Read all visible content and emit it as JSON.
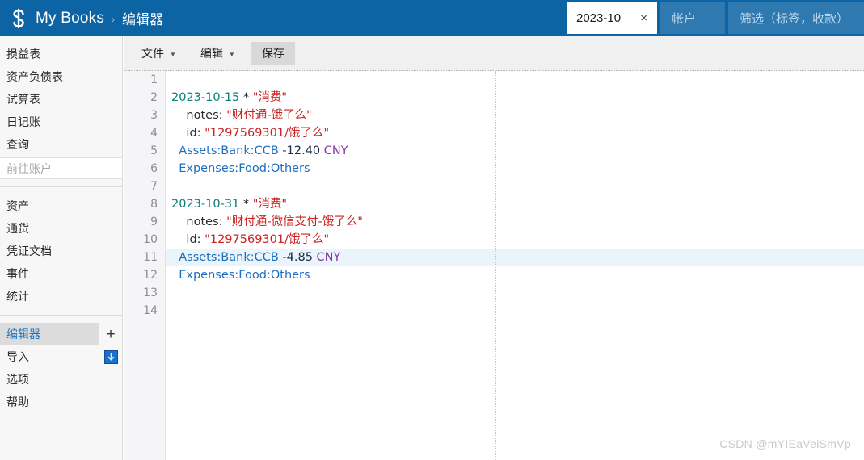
{
  "header": {
    "logo_icon": "beancount-dollar-logo-icon",
    "brand": "My Books",
    "breadcrumb_separator": "›",
    "current_page": "编辑器",
    "date_filter": {
      "value": "2023-10",
      "clear_label": "×"
    },
    "account_filter": {
      "placeholder": "帐户",
      "value": ""
    },
    "tag_filter": {
      "placeholder": "筛选（标签，收款）",
      "value": ""
    },
    "bg_color": "#0d64a5"
  },
  "sidebar": {
    "group1": [
      {
        "label": "损益表",
        "name": "income-statement"
      },
      {
        "label": "资产负债表",
        "name": "balance-sheet"
      },
      {
        "label": "试算表",
        "name": "trial-balance"
      },
      {
        "label": "日记账",
        "name": "journal"
      },
      {
        "label": "查询",
        "name": "query"
      }
    ],
    "goto_account": {
      "placeholder": "前往账户"
    },
    "group2": [
      {
        "label": "资产",
        "name": "assets"
      },
      {
        "label": "通货",
        "name": "commodities"
      },
      {
        "label": "凭证文档",
        "name": "documents"
      },
      {
        "label": "事件",
        "name": "events"
      },
      {
        "label": "统计",
        "name": "statistics"
      }
    ],
    "group3": [
      {
        "label": "编辑器",
        "name": "editor",
        "active": true,
        "action_icon": "plus-icon"
      },
      {
        "label": "导入",
        "name": "import",
        "active": false,
        "action_icon": "download-icon"
      },
      {
        "label": "选项",
        "name": "options",
        "active": false
      },
      {
        "label": "帮助",
        "name": "help",
        "active": false
      }
    ],
    "active_color": "#1f74c0",
    "active_bg": "#dcdcdc"
  },
  "toolbar": {
    "file_menu": "文件",
    "edit_menu": "编辑",
    "save_button": "保存",
    "caret_icon": "chevron-down-icon"
  },
  "editor": {
    "line_count": 14,
    "line_numbers": [
      1,
      2,
      3,
      4,
      5,
      6,
      7,
      8,
      9,
      10,
      11,
      12,
      13,
      14
    ],
    "highlighted_line": 11,
    "ruler_column_on": true,
    "lines": [
      {
        "n": 1,
        "tokens": []
      },
      {
        "n": 2,
        "tokens": [
          {
            "t": "2023-10-15",
            "c": "t-date"
          },
          {
            "t": " * ",
            "c": "t-flag"
          },
          {
            "t": "\"消费\"",
            "c": "t-str"
          }
        ]
      },
      {
        "n": 3,
        "tokens": [
          {
            "t": "    notes: ",
            "c": "t-key"
          },
          {
            "t": "\"财付通-饿了么\"",
            "c": "t-str"
          }
        ]
      },
      {
        "n": 4,
        "tokens": [
          {
            "t": "    id: ",
            "c": "t-key"
          },
          {
            "t": "\"1297569301/饿了么\"",
            "c": "t-str"
          }
        ]
      },
      {
        "n": 5,
        "tokens": [
          {
            "t": "  ",
            "c": "t-key"
          },
          {
            "t": "Assets:Bank:CCB",
            "c": "t-acct"
          },
          {
            "t": " -12.40 ",
            "c": "t-num"
          },
          {
            "t": "CNY",
            "c": "t-cur"
          }
        ]
      },
      {
        "n": 6,
        "tokens": [
          {
            "t": "  ",
            "c": "t-key"
          },
          {
            "t": "Expenses:Food:Others",
            "c": "t-acct"
          }
        ]
      },
      {
        "n": 7,
        "tokens": []
      },
      {
        "n": 8,
        "tokens": [
          {
            "t": "2023-10-31",
            "c": "t-date"
          },
          {
            "t": " * ",
            "c": "t-flag"
          },
          {
            "t": "\"消费\"",
            "c": "t-str"
          }
        ]
      },
      {
        "n": 9,
        "tokens": [
          {
            "t": "    notes: ",
            "c": "t-key"
          },
          {
            "t": "\"财付通-微信支付-饿了么\"",
            "c": "t-str"
          }
        ]
      },
      {
        "n": 10,
        "tokens": [
          {
            "t": "    id: ",
            "c": "t-key"
          },
          {
            "t": "\"1297569301/饿了么\"",
            "c": "t-str"
          }
        ]
      },
      {
        "n": 11,
        "tokens": [
          {
            "t": "  ",
            "c": "t-key"
          },
          {
            "t": "Assets:Bank:CCB",
            "c": "t-acct"
          },
          {
            "t": " -4.85 ",
            "c": "t-num"
          },
          {
            "t": "CNY",
            "c": "t-cur"
          }
        ]
      },
      {
        "n": 12,
        "tokens": [
          {
            "t": "  ",
            "c": "t-key"
          },
          {
            "t": "Expenses:Food:Others",
            "c": "t-acct"
          }
        ]
      },
      {
        "n": 13,
        "tokens": []
      },
      {
        "n": 14,
        "tokens": []
      }
    ],
    "colors": {
      "date": "#0d8079",
      "string": "#cc2222",
      "account": "#1d6fc0",
      "number": "#1b2a4a",
      "currency": "#8a35a8",
      "highlight_bg": "#eaf4fb"
    }
  },
  "watermark": "CSDN @mYIEaVeiSmVp"
}
